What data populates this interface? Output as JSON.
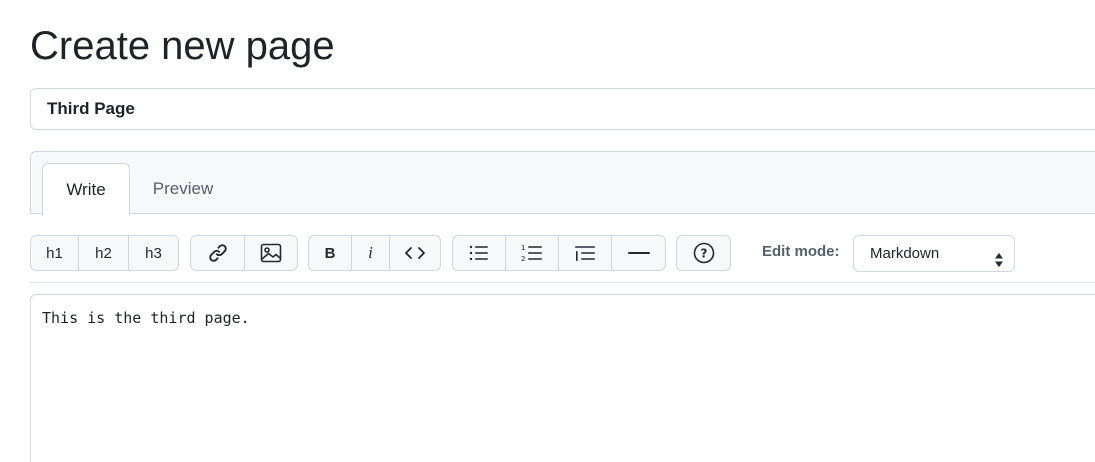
{
  "page": {
    "title": "Create new page"
  },
  "title_field": {
    "value": "Third Page"
  },
  "tabs": [
    {
      "label": "Write",
      "active": true
    },
    {
      "label": "Preview",
      "active": false
    }
  ],
  "toolbar": {
    "headings": [
      "h1",
      "h2",
      "h3"
    ],
    "link_icon": "link-icon",
    "image_icon": "image-icon",
    "bold_label": "B",
    "italic_label": "i",
    "code_icon": "code-icon",
    "unordered_list_icon": "unordered-list-icon",
    "ordered_list_icon": "ordered-list-icon",
    "task_list_icon": "indent-list-icon",
    "horizontal_rule_icon": "horizontal-rule-icon",
    "help_icon": "help-icon"
  },
  "edit_mode": {
    "label": "Edit mode:",
    "selected": "Markdown"
  },
  "body": {
    "content": "This is the third page."
  }
}
